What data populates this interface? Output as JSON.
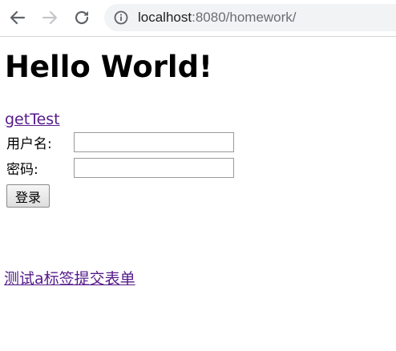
{
  "browser": {
    "url_host": "localhost",
    "url_rest": ":8080/homework/",
    "back_icon": "arrow-left-icon",
    "forward_icon": "arrow-right-icon",
    "reload_icon": "reload-icon",
    "info_icon": "info-icon"
  },
  "page": {
    "title": "Hello World!",
    "get_test_link": "getTest",
    "form": {
      "username_label": "用户名:",
      "username_value": "",
      "password_label": "密码:",
      "password_value": "",
      "login_button": "登录"
    },
    "submit_link": "测试a标签提交表单"
  },
  "colors": {
    "visited_link": "#551a8b",
    "omnibox_bg": "#f1f3f4",
    "url_host": "#202124",
    "url_rest": "#6b6f74"
  }
}
